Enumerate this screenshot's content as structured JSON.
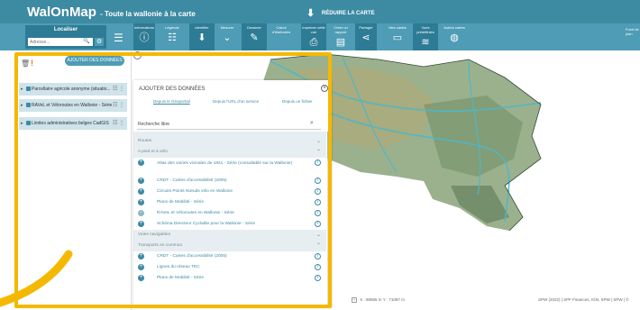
{
  "header": {
    "brand": "WalOnMap",
    "brand_sub": "- Toute la wallonie à la carte",
    "reduce_label": "RÉDUIRE LA CARTE"
  },
  "toolbar": {
    "locate_title": "Localiser",
    "locate_placeholder": "Adresse...",
    "tools": [
      {
        "label": "Informations",
        "icon": "info-icon"
      },
      {
        "label": "Légende",
        "icon": "legend-icon"
      },
      {
        "label": "Identifier",
        "icon": "identify-icon"
      },
      {
        "label": "Mesurer",
        "icon": "chevron-down-icon"
      },
      {
        "label": "Dessiner",
        "icon": "pencil-icon"
      },
      {
        "label": "Calcul d'itinéraires",
        "icon": "route-icon"
      },
      {
        "label": "Imprimer cette vue",
        "icon": "printer-icon"
      },
      {
        "label": "Créer un rapport",
        "icon": "report-icon"
      },
      {
        "label": "Partager",
        "icon": "share-icon"
      },
      {
        "label": "Mes cartes",
        "icon": "folder-icon"
      },
      {
        "label": "Vues prédéfinies",
        "icon": "layers-icon"
      },
      {
        "label": "Autres cartes",
        "icon": "globe-icon"
      }
    ],
    "right_label": "Fond de plan"
  },
  "sidebar": {
    "add_button": "AJOUTER DES DONNÉES",
    "layers": [
      "Parcellaire agricole anonyme (situatio...",
      "RAVeL et Véloroutes en Wallonie - Série",
      "Limites administratives belges CadGIS"
    ]
  },
  "dialog": {
    "title": "AJOUTER DES DONNÉES",
    "tabs": [
      "Depuis le Géoportail",
      "Depuis l'URL d'un service",
      "Depuis un fichier"
    ],
    "search_value": "Recherche libre",
    "rows": [
      {
        "type": "category",
        "label": "Routes"
      },
      {
        "type": "category",
        "label": "A pied et à vélo"
      },
      {
        "type": "item",
        "label": "Atlas des voiries vicinales de 1841 - Série (consultable sur la Wallonie)",
        "tall": true
      },
      {
        "type": "item",
        "label": "CRDT - Cartes d'accessibilité (2005)"
      },
      {
        "type": "item",
        "label": "Circuits Points Nœuds vélo en Wallonie"
      },
      {
        "type": "item",
        "label": "Plans de Mobilité - Série"
      },
      {
        "type": "item",
        "label": "RAVeL et Véloroutes en Wallonie - Série",
        "added": true
      },
      {
        "type": "item",
        "label": "Schéma Directeur Cyclable pour la Wallonie - Série"
      },
      {
        "type": "category",
        "label": "Voies navigables"
      },
      {
        "type": "category",
        "label": "Transports en commun"
      },
      {
        "type": "item",
        "label": "CRDT - Cartes d'accessibilité (2005)"
      },
      {
        "type": "item",
        "label": "Lignes du réseau TEC"
      },
      {
        "type": "item",
        "label": "Plans de Mobilité - Série"
      }
    ]
  },
  "map": {
    "coords": "X : 90665 m   Y : 71097 m",
    "attribution": "SPW (2022) | SPF Finances, IGN, SPW | SPW | ©"
  },
  "colors": {
    "header": "#3d8aa3",
    "toolbar": "#4e9cb5",
    "highlight": "#f5b800",
    "map_green": "#8aa37a",
    "river": "#4fb6c8"
  }
}
